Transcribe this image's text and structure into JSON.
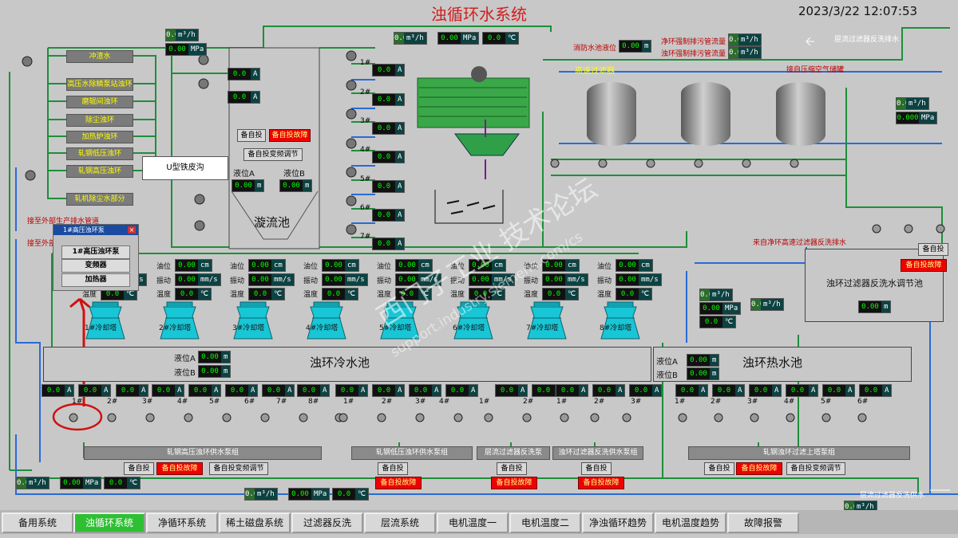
{
  "header": {
    "title": "浊循环水系统",
    "datetime": "2023/3/22 12:07:53"
  },
  "left_labels": [
    "冲渣水",
    "高压水除鳞泵站浊环",
    "磨辊间浊环",
    "除尘浊环",
    "加热炉浊环",
    "轧钢低压浊环",
    "轧钢高压浊环",
    "轧机除尘水部分"
  ],
  "u_trench": "U型铁皮沟",
  "swirl": {
    "name": "漩流池",
    "level_a": "液位A",
    "level_b": "液位B",
    "standby": "备自投",
    "standby_vfd": "备自投变频调节",
    "alarm": "备自投故障"
  },
  "pump_nums": [
    "1#",
    "2#",
    "3#",
    "4#",
    "5#",
    "6#",
    "7#"
  ],
  "common": {
    "zero": "0.0",
    "zero2": "0.00",
    "zero3": "0.000",
    "A": "A",
    "m": "m",
    "m3h": "m³/h",
    "MPa": "MPa",
    "degC": "℃",
    "cm": "cm",
    "mms": "mm/s"
  },
  "top_labels": {
    "fire_level": "消防水池液位",
    "force1": "净环强制排污管流量",
    "force2": "浊环强制排污管流量",
    "backwash_drain": "层流过滤器反洗排水",
    "hs_filter": "高速过滤器",
    "air_tank": "接自压缩空气储罐",
    "ext1": "接至外部生产排水管道",
    "ext2": "接至外部",
    "from_net": "来自净环高速过滤器反洗排水"
  },
  "towers": {
    "oil": "油位",
    "vib": "振动",
    "temp": "温度",
    "names": [
      "1#冷却塔",
      "2#冷却塔",
      "3#冷却塔",
      "4#冷却塔",
      "5#冷却塔",
      "6#冷却塔",
      "7#冷却塔",
      "8#冷却塔"
    ]
  },
  "cold_pool": {
    "name": "浊环冷水池",
    "level_a": "液位A",
    "level_b": "液位B"
  },
  "hot_pool": {
    "name": "浊环热水池",
    "level_a": "液位A",
    "level_b": "液位B"
  },
  "filter_pool": {
    "name": "浊环过滤器反洗水调节池",
    "standby": "备自投",
    "alarm": "备自投故障"
  },
  "groups": [
    {
      "name": "轧钢高压浊环供水泵组",
      "nums": [
        "1#",
        "2#",
        "3#",
        "4#",
        "5#",
        "6#",
        "7#",
        "8#"
      ]
    },
    {
      "name": "轧钢低压浊环供水泵组",
      "nums": [
        "1#",
        "2#",
        "3#",
        "4#"
      ]
    },
    {
      "name": "层流过滤器反洗泵",
      "nums": [
        "1#",
        "2#"
      ]
    },
    {
      "name": "浊环过滤器反洗供水泵组",
      "nums": [
        "1#",
        "2#",
        "3#"
      ]
    },
    {
      "name": "轧钢浊环过滤上塔泵组",
      "nums": [
        "1#",
        "2#",
        "3#",
        "4#",
        "5#",
        "6#"
      ]
    }
  ],
  "bottom_labels": {
    "standby": "备自投",
    "vfd": "备自投变频调节",
    "alarm": "备自投故障",
    "laminar_supply": "层流过滤器反洗供水"
  },
  "popup": {
    "title": "1#高压浊环泵",
    "buttons": [
      "1#高压浊环泵",
      "变频器",
      "加热器"
    ]
  },
  "watermark": {
    "cn": "西门子工业 技术论坛",
    "en": "support.industry.siemens.com/cs"
  },
  "nav": [
    "备用系统",
    "浊循环系统",
    "净循环系统",
    "稀土磁盘系统",
    "过滤器反洗",
    "层流系统",
    "电机温度一",
    "电机温度二",
    "净浊循环趋势",
    "电机温度趋势",
    "故障报警"
  ],
  "colors": {
    "bg": "#c8c8c8",
    "pipe": "#1d8f3a",
    "water": "#2a6ad8",
    "tower": "#18c6d6",
    "value": "#00ff00",
    "alarm": "#e00000",
    "nav_active": "#2fbf33",
    "title": "#d31e1e"
  }
}
